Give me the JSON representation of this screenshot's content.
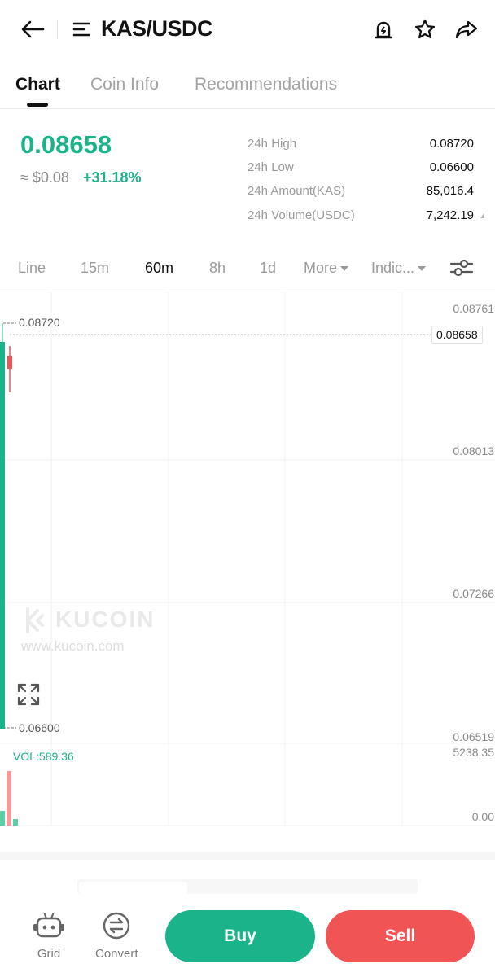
{
  "header": {
    "pair": "KAS/USDC",
    "icons": [
      "back-arrow-icon",
      "menu-icon",
      "alert-bell-icon",
      "star-icon",
      "share-icon"
    ]
  },
  "tabs": [
    {
      "label": "Chart",
      "active": true
    },
    {
      "label": "Coin Info",
      "active": false
    },
    {
      "label": "Recommendations",
      "active": false
    }
  ],
  "ticker": {
    "price": "0.08658",
    "fiat": "≈ $0.08",
    "change": "+31.18%",
    "stats": [
      {
        "label": "24h High",
        "value": "0.08720"
      },
      {
        "label": "24h Low",
        "value": "0.06600"
      },
      {
        "label": "24h Amount(KAS)",
        "value": "85,016.4"
      },
      {
        "label": "24h Volume(USDC)",
        "value": "7,242.19"
      }
    ],
    "up_color": "#1bb48a",
    "down_color": "#f05454"
  },
  "intervals": {
    "items": [
      "Line",
      "15m",
      "60m",
      "8h",
      "1d",
      "More",
      "Indic..."
    ],
    "active": "60m"
  },
  "chart": {
    "y_labels": [
      "0.08761",
      "0.08013",
      "0.07266",
      "0.06519"
    ],
    "current_price": "0.08658",
    "high_marker": "0.08720",
    "low_marker": "0.06600",
    "volume_label": "VOL:589.36",
    "volume_max": "5238.35",
    "volume_zero": "0.00",
    "watermark_name": "KUCOIN",
    "watermark_url": "www.kucoin.com"
  },
  "bottom": {
    "grid_label": "Grid",
    "convert_label": "Convert",
    "buy_label": "Buy",
    "sell_label": "Sell"
  }
}
